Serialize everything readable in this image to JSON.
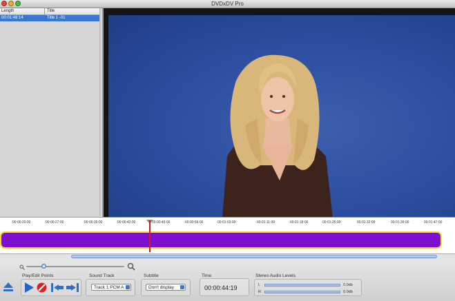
{
  "window": {
    "title": "DVDxDV Pro"
  },
  "list": {
    "columns": [
      "Length",
      "Title"
    ],
    "rows": [
      {
        "length": "00:01:48:14",
        "title": "Title 1 -01"
      }
    ]
  },
  "timeline": {
    "ticks": [
      "00:00:20:00",
      "00:00:27:00",
      "00:00:35:00",
      "00:00:42:00",
      "00:00:49:00",
      "00:00:56:00",
      "00:01:03:00",
      "00:01:11:00",
      "00:01:18:00",
      "00:01:25:00",
      "00:01:32:00",
      "00:01:39:00",
      "00:01:47:00"
    ]
  },
  "controls": {
    "play_edit_label": "Play/Edit Points",
    "sound_track_label": "Sound Track",
    "sound_track_value": "Track 1 PCM A",
    "subtitle_label": "Subtitle",
    "subtitle_value": "Don't display",
    "time_label": "Time",
    "time_value": "00:00:44:19",
    "levels_label": "Stereo Audio Levels",
    "left_channel": "L",
    "right_channel": "R",
    "left_db": "0.0db",
    "right_db": "0.0db"
  },
  "colors": {
    "accent": "#3a77d4",
    "clip": "#7d0fd0",
    "clip_border": "#f0dc1a",
    "playhead": "#d01919"
  }
}
